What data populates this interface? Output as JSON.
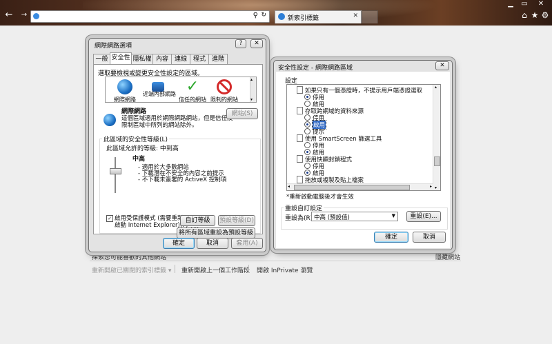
{
  "browser": {
    "tab_title": "新索引標籤",
    "address_value": "",
    "newtab_icon": "new-tab-icon",
    "toolbar_icons": [
      "home-icon",
      "favorites-icon",
      "tools-icon"
    ],
    "window_buttons": [
      "minimize-icon",
      "maximize-icon",
      "close-icon"
    ]
  },
  "newtab_page": {
    "discover_text": "探索您可能喜歡的其他網站",
    "hide_sites": "隱藏網站",
    "reopen_closed_tabs": "重新開啟已關閉的索引標籤",
    "reopen_last_session": "重新開啟上一個工作階段",
    "inprivate": "開啟 InPrivate 瀏覽"
  },
  "internet_options": {
    "title": "網際網路選項",
    "help": "?",
    "close": "✕",
    "tabs": [
      "一般",
      "安全性",
      "隱私權",
      "內容",
      "連線",
      "程式",
      "進階"
    ],
    "active_tab": 1,
    "zone_prompt": "選取要檢視或變更安全性設定的區域。",
    "zones": [
      {
        "label": "網際網路",
        "icon": "internet-zone-icon"
      },
      {
        "label": "近端內部網路",
        "icon": "intranet-zone-icon"
      },
      {
        "label": "信任的網站",
        "icon": "trusted-sites-icon"
      },
      {
        "label": "限制的網站",
        "icon": "restricted-sites-icon"
      }
    ],
    "zone_name": "網際網路",
    "zone_desc_1": "這個區域適用於網際網路網站，但是信任及",
    "zone_desc_2": "限制區域中所列的網站除外。",
    "sites_button": "網站(S)",
    "security_level_group": "此區域的安全性等級(L)",
    "allowed_levels": "此區域允許的等級: 中到高",
    "level_name": "中高",
    "level_bullets": [
      "- 適用於大多數網站",
      "- 下載潛在不安全的內容之前提示",
      "- 不下載未簽署的 ActiveX 控制項"
    ],
    "protected_mode_1": "啟用受保護模式 (需要重新",
    "protected_mode_2": "啟動 Internet Explorer)(P)",
    "protected_mode_checked": true,
    "custom_level_button": "自訂等級(C)...",
    "default_level_button": "預設等級(D)",
    "reset_all_button": "將所有區域重設為預設等級(R)",
    "ok": "確定",
    "cancel": "取消",
    "apply": "套用(A)"
  },
  "security_settings": {
    "title": "安全性設定 - 網際網路區域",
    "close": "✕",
    "settings_label": "設定",
    "rows": [
      {
        "kind": "item",
        "text": "如果只有一個憑證時，不提示用戶端憑證選取"
      },
      {
        "kind": "option",
        "text": "停用",
        "selected": true
      },
      {
        "kind": "option",
        "text": "啟用",
        "selected": false
      },
      {
        "kind": "item",
        "text": "存取跨網域的資料來源"
      },
      {
        "kind": "option",
        "text": "停用",
        "selected": false
      },
      {
        "kind": "option",
        "text": "啟用",
        "selected": true,
        "highlight": true
      },
      {
        "kind": "option",
        "text": "提示",
        "selected": false
      },
      {
        "kind": "item",
        "text": "使用 SmartScreen 篩選工具"
      },
      {
        "kind": "option",
        "text": "停用",
        "selected": false
      },
      {
        "kind": "option",
        "text": "啟用",
        "selected": true
      },
      {
        "kind": "item",
        "text": "使用快顯封鎖程式"
      },
      {
        "kind": "option",
        "text": "停用",
        "selected": false
      },
      {
        "kind": "option",
        "text": "啟用",
        "selected": true
      },
      {
        "kind": "item",
        "text": "拖放或複製及貼上檔案"
      }
    ],
    "restart_note": "*重新啟動電腦後才會生效",
    "reset_group": "重設自訂設定",
    "reset_to_label": "重設為(R):",
    "reset_to_value": "中高 (預設值)",
    "reset_button": "重設(E)...",
    "ok": "確定",
    "cancel": "取消"
  }
}
